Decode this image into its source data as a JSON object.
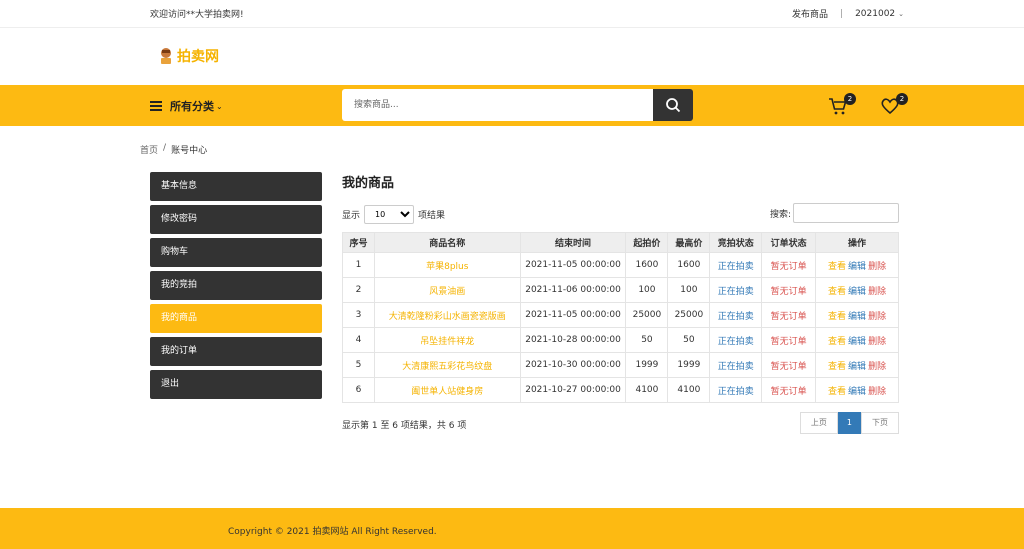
{
  "topbar": {
    "welcome": "欢迎访问**大学拍卖网!",
    "publish": "发布商品",
    "separator": "|",
    "username": "2021002"
  },
  "logo": {
    "text": "拍卖网"
  },
  "nav": {
    "category_label": "所有分类",
    "search_placeholder": "搜索商品...",
    "cart_count": "2",
    "wishlist_count": "2"
  },
  "breadcrumb": {
    "home": "首页",
    "separator": "/",
    "current": "账号中心"
  },
  "sidebar": {
    "items": [
      {
        "label": "基本信息"
      },
      {
        "label": "修改密码"
      },
      {
        "label": "购物车"
      },
      {
        "label": "我的竞拍"
      },
      {
        "label": "我的商品"
      },
      {
        "label": "我的订单"
      },
      {
        "label": "退出"
      }
    ],
    "active_index": 4
  },
  "main": {
    "title": "我的商品",
    "show_label": "显示",
    "page_size": "10",
    "entries_label": "项结果",
    "search_label": "搜索:",
    "columns": [
      "序号",
      "商品名称",
      "结束时间",
      "起拍价",
      "最高价",
      "竞拍状态",
      "订单状态",
      "操作"
    ],
    "rows": [
      {
        "no": "1",
        "name": "苹果8plus",
        "end": "2021-11-05 00:00:00",
        "start": "1600",
        "max": "1600",
        "bid": "正在拍卖",
        "order": "暂无订单"
      },
      {
        "no": "2",
        "name": "风景油画",
        "end": "2021-11-06 00:00:00",
        "start": "100",
        "max": "100",
        "bid": "正在拍卖",
        "order": "暂无订单"
      },
      {
        "no": "3",
        "name": "大清乾隆粉彩山水画瓷瓷版画",
        "end": "2021-11-05 00:00:00",
        "start": "25000",
        "max": "25000",
        "bid": "正在拍卖",
        "order": "暂无订单"
      },
      {
        "no": "4",
        "name": "吊坠挂件祥龙",
        "end": "2021-10-28 00:00:00",
        "start": "50",
        "max": "50",
        "bid": "正在拍卖",
        "order": "暂无订单"
      },
      {
        "no": "5",
        "name": "大清康熙五彩花鸟纹盘",
        "end": "2021-10-30 00:00:00",
        "start": "1999",
        "max": "1999",
        "bid": "正在拍卖",
        "order": "暂无订单"
      },
      {
        "no": "6",
        "name": "阖世单人站健身房",
        "end": "2021-10-27 00:00:00",
        "start": "4100",
        "max": "4100",
        "bid": "正在拍卖",
        "order": "暂无订单"
      }
    ],
    "actions": {
      "view": "查看",
      "edit": "编辑",
      "delete": "删除"
    },
    "info": "显示第 1 至 6 项结果，共 6 项",
    "pager": {
      "prev": "上页",
      "current": "1",
      "next": "下页"
    }
  },
  "footer": {
    "text": "Copyright © 2021 拍卖网站 All Right Reserved."
  },
  "colors": {
    "accent": "#fdba12",
    "dark": "#333333",
    "link_blue": "#337ab7",
    "danger": "#d9534f"
  }
}
